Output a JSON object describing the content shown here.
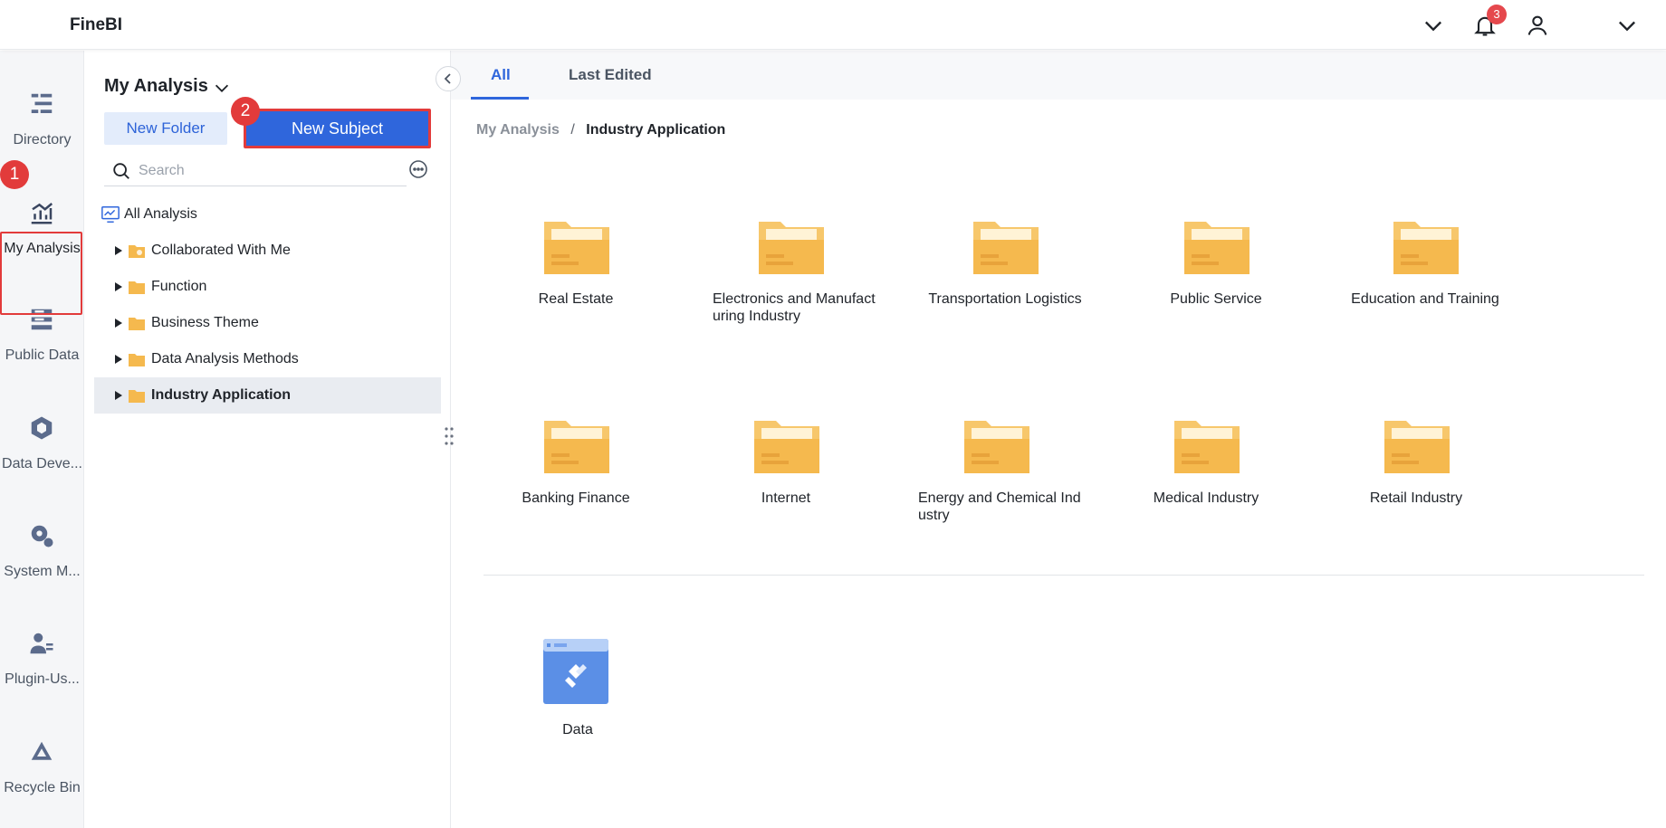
{
  "header": {
    "brand": "FineBI",
    "notification_count": "3"
  },
  "leftnav": {
    "items": [
      {
        "label": "Directory",
        "icon": "directory-icon"
      },
      {
        "label": "My Analysis",
        "icon": "analysis-chart-icon",
        "active": true
      },
      {
        "label": "Public Data",
        "icon": "public-data-icon"
      },
      {
        "label": "Data Deve...",
        "icon": "data-development-icon"
      },
      {
        "label": "System M...",
        "icon": "system-management-icon"
      },
      {
        "label": "Plugin-Us...",
        "icon": "plugin-user-icon"
      },
      {
        "label": "Recycle Bin",
        "icon": "recycle-bin-icon"
      }
    ],
    "step_badge": "1"
  },
  "tree_panel": {
    "title": "My Analysis",
    "new_folder_label": "New Folder",
    "new_subject_label": "New Subject",
    "step_badge": "2",
    "search_placeholder": "Search",
    "root_label": "All Analysis",
    "items": [
      {
        "label": "Collaborated With Me",
        "icon": "shared-folder-icon"
      },
      {
        "label": "Function",
        "icon": "folder-icon"
      },
      {
        "label": "Business Theme",
        "icon": "folder-icon"
      },
      {
        "label": "Data Analysis Methods",
        "icon": "folder-icon"
      },
      {
        "label": "Industry Application",
        "icon": "folder-icon",
        "selected": true
      }
    ]
  },
  "main": {
    "tabs": [
      {
        "label": "All",
        "active": true
      },
      {
        "label": "Last Edited"
      }
    ],
    "breadcrumb": {
      "parent": "My Analysis",
      "separator": "/",
      "current": "Industry Application"
    },
    "folders": [
      "Real Estate",
      "Electronics and Manufacturing Industry",
      "Transportation Logistics",
      "Public Service",
      "Education and Training",
      "Banking Finance",
      "Internet",
      "Energy and Chemical Industry",
      "Medical Industry",
      "Retail Industry"
    ],
    "data_item": "Data"
  },
  "colors": {
    "primary": "#2f66dc",
    "highlight_red": "#e23b3b",
    "folder_yellow": "#f5b94e",
    "data_blue": "#4a86e8"
  }
}
